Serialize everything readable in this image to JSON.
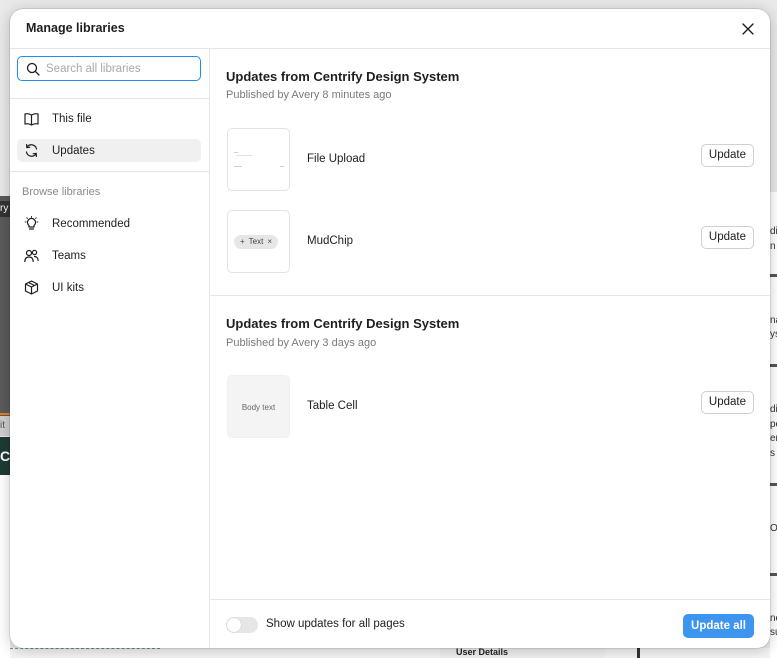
{
  "modal": {
    "title": "Manage libraries",
    "close_icon": "close-icon"
  },
  "sidebar": {
    "search": {
      "placeholder": "Search all libraries",
      "value": ""
    },
    "items": [
      {
        "label": "This file",
        "icon": "book-icon",
        "active": false
      },
      {
        "label": "Updates",
        "icon": "refresh-icon",
        "active": true
      }
    ],
    "browse_heading": "Browse libraries",
    "browse_items": [
      {
        "label": "Recommended",
        "icon": "lightbulb-icon"
      },
      {
        "label": "Teams",
        "icon": "people-icon"
      },
      {
        "label": "UI kits",
        "icon": "package-icon"
      }
    ]
  },
  "groups": [
    {
      "title": "Updates from Centrify Design System",
      "subtitle": "Published by Avery 8 minutes ago",
      "components": [
        {
          "name": "File Upload",
          "button": "Update"
        },
        {
          "name": "MudChip",
          "button": "Update",
          "thumb_text": "Text"
        }
      ]
    },
    {
      "title": "Updates from Centrify Design System",
      "subtitle": "Published by Avery 3 days ago",
      "components": [
        {
          "name": "Table Cell",
          "button": "Update",
          "thumb_text": "Body text"
        }
      ]
    }
  ],
  "footer": {
    "toggle_label": "Show updates for all pages",
    "toggle_on": false,
    "update_all": "Update all"
  },
  "background": {
    "left_label": "ry",
    "left_grey": "it",
    "left_teal": "C",
    "bottom_label": "User Details",
    "right_texts": [
      "di",
      "n t",
      "na",
      "ys",
      "di",
      "pe",
      "ere",
      "s",
      "Or",
      "ne",
      "su"
    ]
  },
  "colors": {
    "accent": "#3d95ef",
    "focus": "#1a8ef2",
    "active_bg": "#f0f0f0"
  }
}
